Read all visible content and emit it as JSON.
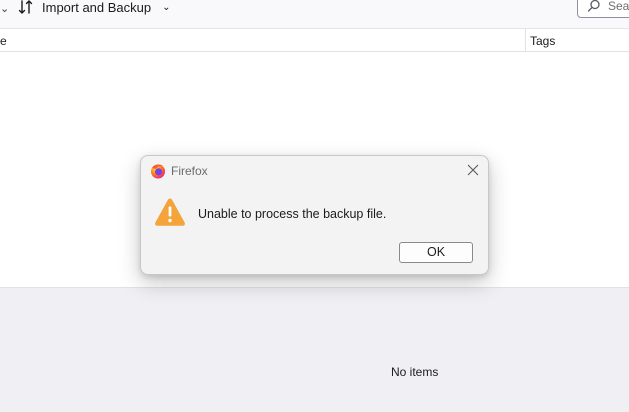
{
  "toolbar": {
    "import_backup_label": "Import and Backup",
    "search_placeholder": "Sear"
  },
  "columns": {
    "name_partial": "e",
    "tags": "Tags"
  },
  "details": {
    "empty_message": "No items"
  },
  "dialog": {
    "title": "Firefox",
    "message": "Unable to process the backup file.",
    "ok_label": "OK"
  },
  "icons": {
    "app": "firefox-logo-icon",
    "warning": "warning-icon",
    "close": "close-icon",
    "sort": "sort-arrows-icon",
    "search": "search-icon"
  },
  "colors": {
    "warning": "#f5a33b",
    "dialog_bg": "#f3f3f3",
    "lower_pane_bg": "#f0f0f4"
  }
}
